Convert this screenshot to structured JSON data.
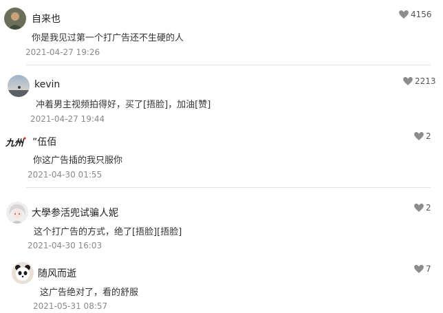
{
  "colors": {
    "heart": "#8c8c8c",
    "divider": "#e3e3e3",
    "timestamp": "#8a8a8a"
  },
  "comments": [
    {
      "username": "自来也",
      "content": "你是我见过第一个打广告还不生硬的人",
      "time": "2021-04-27 19:26",
      "likes": "4156",
      "avatar_icon": "avatar-photo-icon"
    },
    {
      "username": "kevin",
      "content": "冲着男主视频拍得好，买了[捂脸]，加油[赞]",
      "time": "2021-04-27 19:44",
      "likes": "2213",
      "avatar_icon": "avatar-sky-icon"
    },
    {
      "username": "”伍佰",
      "content": "你这广告插的我只服你",
      "time": "2021-04-30 01:55",
      "likes": "2",
      "avatar_icon": "avatar-calligraphy-icon",
      "avatar_text": "九州"
    },
    {
      "username": "大學参活兜试骗人妮",
      "content": "这个打广告的方式，绝了[捂脸][捂脸]",
      "time": "2021-04-30 16:03",
      "likes": "2",
      "avatar_icon": "avatar-anime-icon"
    },
    {
      "username": "随风而逝",
      "content": "这广告绝对了，看的舒服",
      "time": "2021-05-31 08:57",
      "likes": "7",
      "avatar_icon": "avatar-panda-icon"
    }
  ]
}
